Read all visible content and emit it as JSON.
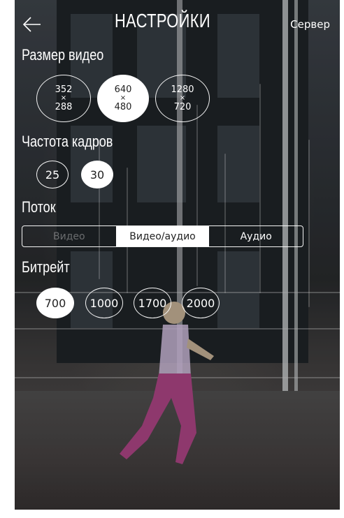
{
  "header": {
    "title": "НАСТРОЙКИ",
    "server_label": "Сервер",
    "back_icon": "arrow-left-icon"
  },
  "video_size": {
    "label": "Размер видео",
    "options": [
      {
        "w": "352",
        "x": "×",
        "h": "288",
        "selected": false
      },
      {
        "w": "640",
        "x": "×",
        "h": "480",
        "selected": true
      },
      {
        "w": "1280",
        "x": "×",
        "h": "720",
        "selected": false
      }
    ]
  },
  "frame_rate": {
    "label": "Частота кадров",
    "options": [
      {
        "value": "25",
        "selected": false
      },
      {
        "value": "30",
        "selected": true
      }
    ]
  },
  "stream": {
    "label": "Поток",
    "options": [
      {
        "value": "Видео",
        "selected": false,
        "disabled": true
      },
      {
        "value": "Видео/аудио",
        "selected": true
      },
      {
        "value": "Аудио",
        "selected": false
      }
    ]
  },
  "bitrate": {
    "label": "Битрейт",
    "options": [
      {
        "value": "700",
        "selected": true
      },
      {
        "value": "1000",
        "selected": false
      },
      {
        "value": "1700",
        "selected": false
      },
      {
        "value": "2000",
        "selected": false
      }
    ]
  },
  "colors": {
    "selected_fill": "#ffffff",
    "text": "#ffffff"
  }
}
